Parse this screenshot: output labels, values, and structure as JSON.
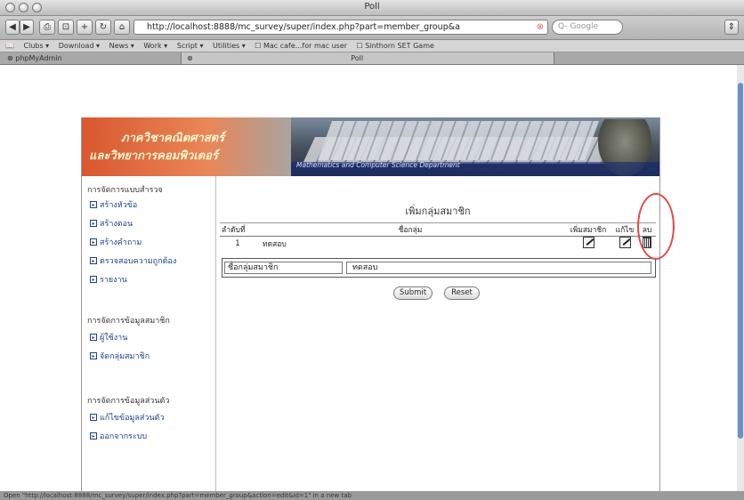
{
  "window": {
    "title": "Poll"
  },
  "toolbar": {
    "url": "http://localhost:8888/mc_survey/super/index.php?part=member_group&a",
    "search_placeholder": "Q- Google"
  },
  "bookmarks": [
    "Clubs ▾",
    "Download ▾",
    "News ▾",
    "Work ▾",
    "Script ▾",
    "Utilities ▾",
    "☐ Mac cafe...for mac user",
    "☐ Sinthorn SET Game"
  ],
  "tabs": [
    {
      "label": "phpMyAdmin",
      "active": false
    },
    {
      "label": "Poll",
      "active": true
    }
  ],
  "banner": {
    "line1": "ภาควิชาคณิตศาสตร์",
    "line2": "และวิทยาการคอมพิวเตอร์",
    "subline": "Mathematics and Computer Science Department"
  },
  "sidebar": {
    "sections": [
      {
        "title": "การจัดการแบบสำรวจ",
        "items": [
          "สร้างหัวข้อ",
          "สร้างตอน",
          "สร้างคำถาม",
          "ตรวจสอบความถูกต้อง",
          "รายงาน"
        ]
      },
      {
        "title": "การจัดการข้อมูลสมาชิก",
        "items": [
          "ผู้ใช้งาน",
          "จัดกลุ่มสมาชิก"
        ]
      },
      {
        "title": "การจัดการข้อมูลส่วนตัว",
        "items": [
          "แก้ไขข้อมูลส่วนตัว",
          "ออกจากระบบ"
        ]
      }
    ]
  },
  "main": {
    "title": "เพิ่มกลุ่มสมาชิก",
    "columns": [
      "ลำดับที่",
      "ชื่อกลุ่ม",
      "เพิ่มสมาชิก",
      "แก้ไข",
      "ลบ"
    ],
    "rows": [
      {
        "no": "1",
        "name": "ทดสอบ"
      }
    ],
    "form_label": "ชื่อกลุ่มสมาชิก",
    "form_value": "ทดสอบ",
    "submit_label": "Submit",
    "reset_label": "Reset"
  },
  "statusbar": {
    "text": "Open \"http://localhost:8888/mc_survey/super/index.php?part=member_group&action=edit&id=1\" in a new tab"
  },
  "colors": {
    "annotation_circle": "#e24a4a",
    "link": "#1a3f8a",
    "banner": "#d9572f"
  }
}
